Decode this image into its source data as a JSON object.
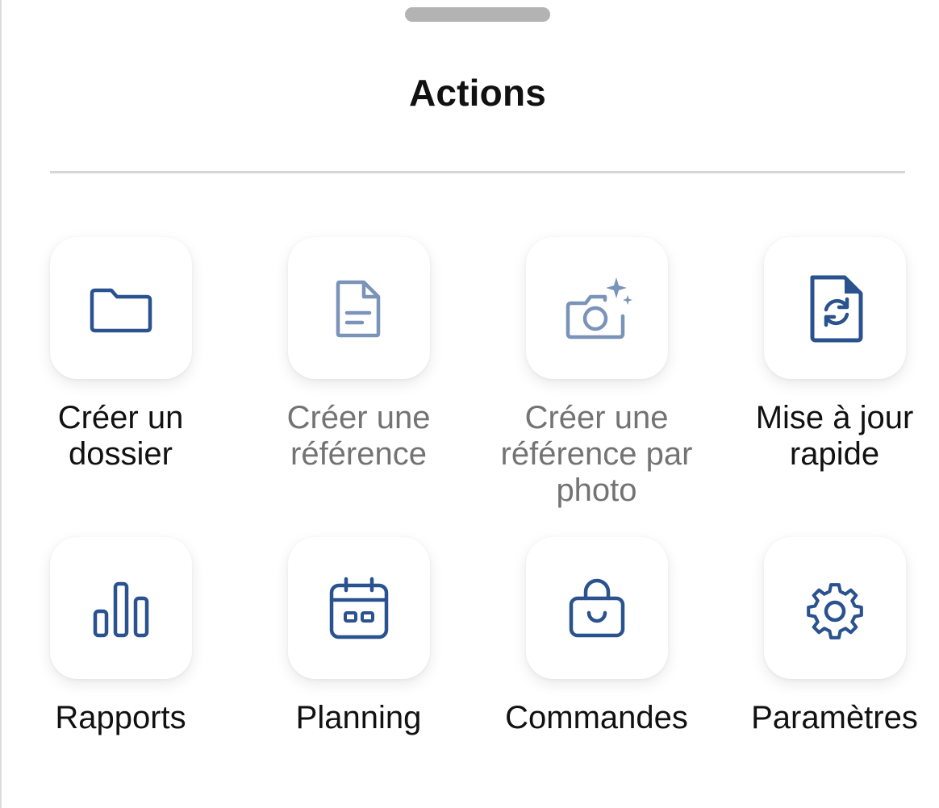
{
  "sheet": {
    "title": "Actions"
  },
  "colors": {
    "icon": "#29528f",
    "label": "#111111",
    "label_disabled": "#737373",
    "divider": "#d6d6d6",
    "grabber": "#b3b3b3"
  },
  "actions": [
    {
      "label": "Créer un dossier",
      "icon": "folder-icon",
      "enabled": true
    },
    {
      "label": "Créer une référence",
      "icon": "document-icon",
      "enabled": false
    },
    {
      "label": "Créer une référence par photo",
      "icon": "camera-sparkle-icon",
      "enabled": false
    },
    {
      "label": "Mise à jour rapide",
      "icon": "file-sync-icon",
      "enabled": true
    },
    {
      "label": "Rapports",
      "icon": "bar-chart-icon",
      "enabled": true
    },
    {
      "label": "Planning",
      "icon": "calendar-icon",
      "enabled": true
    },
    {
      "label": "Commandes",
      "icon": "shopping-bag-icon",
      "enabled": true
    },
    {
      "label": "Paramètres",
      "icon": "gear-icon",
      "enabled": true
    }
  ]
}
